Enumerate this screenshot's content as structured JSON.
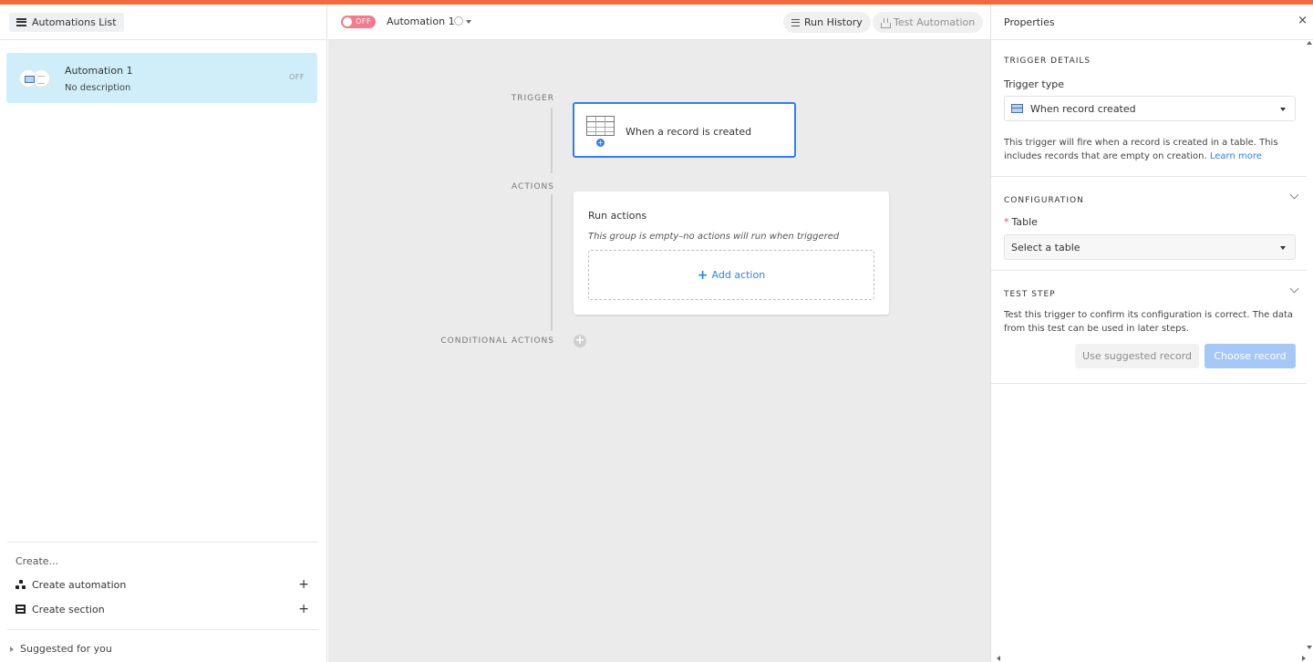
{
  "colors": {
    "accent": "#f5673d",
    "primary_blue": "#2d7ff9",
    "selected_bg": "#cfeefa",
    "toggle_off": "#f47a8c",
    "canvas_bg": "#ebebeb"
  },
  "sidebar": {
    "list_button_label": "Automations List",
    "automation": {
      "name": "Automation 1",
      "description": "No description",
      "status": "OFF"
    },
    "create_heading": "Create...",
    "create_automation": "Create automation",
    "create_section": "Create section",
    "plus": "+",
    "suggested": "Suggested for you"
  },
  "header": {
    "toggle_label": "OFF",
    "automation_title": "Automation 1",
    "run_history": "Run History",
    "test_automation": "Test Automation"
  },
  "canvas": {
    "trigger_label": "TRIGGER",
    "actions_label": "ACTIONS",
    "conditional_label": "CONDITIONAL ACTIONS",
    "trigger_text": "When a record is created",
    "run_actions": "Run actions",
    "empty_note": "This group is empty–no actions will run when triggered",
    "add_action": "Add action",
    "add_plus": "+",
    "cond_plus": "+"
  },
  "properties": {
    "title": "Properties",
    "close": "×",
    "trigger_details": "TRIGGER DETAILS",
    "trigger_type_label": "Trigger type",
    "trigger_type_value": "When record created",
    "trigger_desc": "This trigger will fire when a record is created in a table. This includes records that are empty on creation.",
    "learn_more": "Learn more",
    "configuration": "CONFIGURATION",
    "required_mark": "*",
    "table_label": "Table",
    "table_placeholder": "Select a table",
    "test_step": "TEST STEP",
    "test_desc": "Test this trigger to confirm its configuration is correct. The data from this test can be used in later steps.",
    "use_suggested": "Use suggested record",
    "choose_record": "Choose record"
  }
}
